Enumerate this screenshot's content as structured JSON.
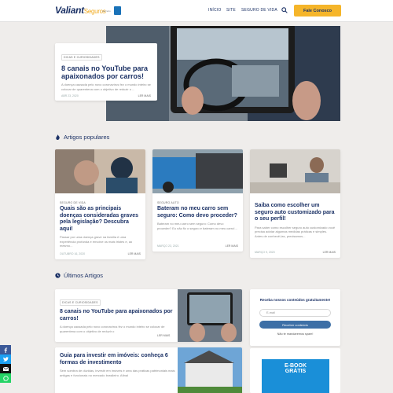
{
  "header": {
    "logo_main": "Valiant",
    "logo_sub": "Seguros",
    "logo_partner": "parceiro",
    "nav": [
      "INÍCIO",
      "SITE",
      "SEGURO DE VIDA"
    ],
    "cta_label": "Fale Conosco"
  },
  "hero": {
    "tag": "DICAS E CURIOSIDADES",
    "title": "8 canais no YouTube para apaixonados por carros!",
    "excerpt": "A doença causada pelo novo coronavírus fez o mundo inteiro se colocar de quarentena com o objetivo de reduzir o ...",
    "date": "ABR 23, 2020",
    "more": "LER MAIS"
  },
  "popular": {
    "title": "Artigos populares",
    "cards": [
      {
        "category": "SEGURO DE VIDA",
        "title": "Quais são as principais doenças consideradas graves pela legislação? Descubra aqui!",
        "excerpt": "Passar por uma doença grave na família é uma experiência profunda e envolve os mais tristes e, ao mesmo...",
        "date": "OUTUBRO 16, 2020",
        "more": "LER MAIS"
      },
      {
        "category": "SEGURO AUTO",
        "title": "Bateram no meu carro sem seguro: Como devo proceder?",
        "excerpt": "Bateram no meu carro sem seguro: Como devo proceder? Eu não fiz o seguro e bateram no meu carro!...",
        "date": "MARÇO 23, 2021",
        "more": "LER MAIS"
      },
      {
        "category": "",
        "title": "Saiba como escolher um seguro auto customizado para o seu perfil!",
        "excerpt": "Para saber como escolher seguro auto customizado você precisa adotar algumas medidas práticas e simples. Antes de conhecê-las, precisamos...",
        "date": "MARÇO 9, 2020",
        "more": "LER MAIS"
      }
    ]
  },
  "latest": {
    "title": "Últimos Artigos",
    "items": [
      {
        "tag": "DICAS E CURIOSIDADES",
        "title": "8 canais no YouTube para apaixonados por carros!",
        "excerpt": "A doença causada pelo novo coronavírus fez o mundo inteiro se colocar de quarentena com o objetivo de reduzir o",
        "more": "LER MAIS"
      },
      {
        "tag": "",
        "title": "Guia para investir em imóveis: conheça 6 formas de investimento",
        "excerpt": "Sem sombra de dúvidas, investir em imóveis é uma das práticas patrimoniais mais antigas e funcionais no mercado brasileiro. Afinal",
        "more": "LER MAIS"
      }
    ]
  },
  "newsletter": {
    "heading": "Receba nossos conteúdos gratuitamente!",
    "placeholder": "E-mail",
    "button": "Receber conteúdo",
    "footnote": "Não te mandaremos spam!"
  },
  "ebook": {
    "label_1": "E-BOOK",
    "label_2": "GRÁTIS"
  },
  "colors": {
    "navy": "#1c3266",
    "accent": "#f5b52a",
    "button": "#3d6fa6",
    "ebook": "#1a8fd8"
  },
  "social": [
    "facebook-icon",
    "twitter-icon",
    "email-icon",
    "whatsapp-icon"
  ]
}
